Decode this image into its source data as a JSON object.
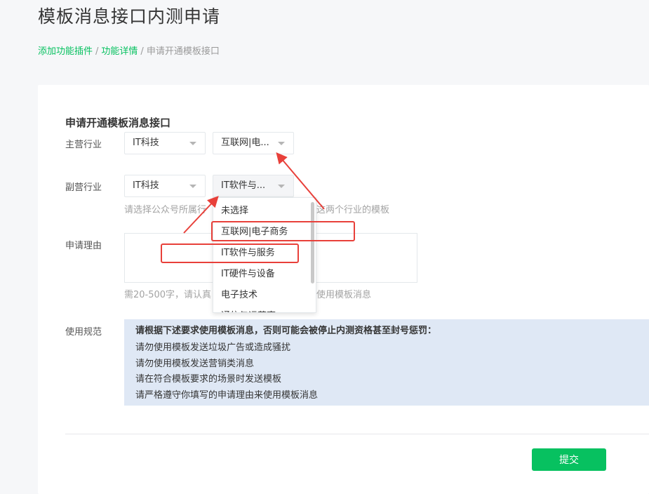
{
  "page": {
    "title": "模板消息接口内测申请"
  },
  "breadcrumb": {
    "items": [
      "添加功能插件",
      "功能详情",
      "申请开通模板接口"
    ],
    "separator": "/"
  },
  "form": {
    "section_title": "申请开通模板消息接口",
    "main_industry": {
      "label": "主营行业",
      "primary_value": "IT科技",
      "secondary_value": "互联网|电..."
    },
    "sub_industry": {
      "label": "副营行业",
      "primary_value": "IT科技",
      "secondary_value": "IT软件与...",
      "hint_left": "请选择公众号所属行",
      "hint_right": "这两个行业的模板"
    },
    "reason": {
      "label": "申请理由",
      "value": "",
      "hint_left": "需20-500字，请认真",
      "hint_right": "使用模板消息"
    },
    "rules": {
      "label": "使用规范",
      "heading": "请根据下述要求使用模板消息，否则可能会被停止内测资格甚至封号惩罚：",
      "items": [
        "请勿使用模板发送垃圾广告或造成骚扰",
        "请勿使用模板发送营销类消息",
        "请在符合模板要求的场景时发送模板",
        "请严格遵守你填写的申请理由来使用模板消息"
      ]
    },
    "submit_label": "提交"
  },
  "dropdown": {
    "options": [
      "未选择",
      "互联网|电子商务",
      "IT软件与服务",
      "IT硬件与设备",
      "电子技术",
      "通信与运营商"
    ]
  },
  "colors": {
    "accent": "#07c160",
    "annotation_red": "#e8403a",
    "rules_background": "#dfe8f5"
  }
}
